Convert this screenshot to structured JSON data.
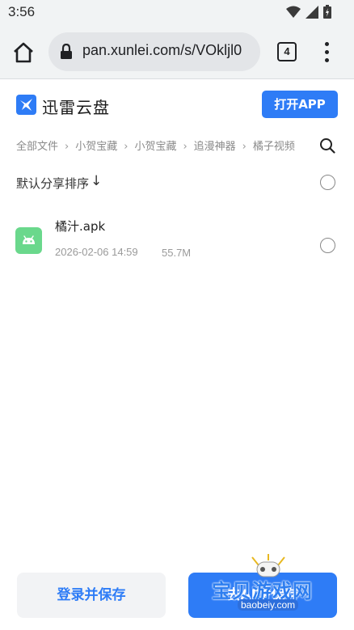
{
  "status_bar": {
    "time": "3:56"
  },
  "browser": {
    "url": "pan.xunlei.com/s/VOkljl0",
    "tab_count": "4"
  },
  "app": {
    "name": "迅雷云盘",
    "open_app_label": "打开APP",
    "brand_color": "#2e7cf6"
  },
  "breadcrumb": [
    "全部文件",
    "小贺宝藏",
    "小贺宝藏",
    "追漫神器",
    "橘子视频"
  ],
  "sort": {
    "label": "默认分享排序",
    "arrow": "↓"
  },
  "files": [
    {
      "name": "橘汁.apk",
      "date": "2026-02-06 14:59",
      "size": "55.7M",
      "icon": "android-app-icon"
    }
  ],
  "actions": {
    "login_save": "登录并保存",
    "app_save": "去APP保存"
  },
  "watermark": {
    "title": "宝贝游戏网",
    "url": "baobeiy.com"
  }
}
